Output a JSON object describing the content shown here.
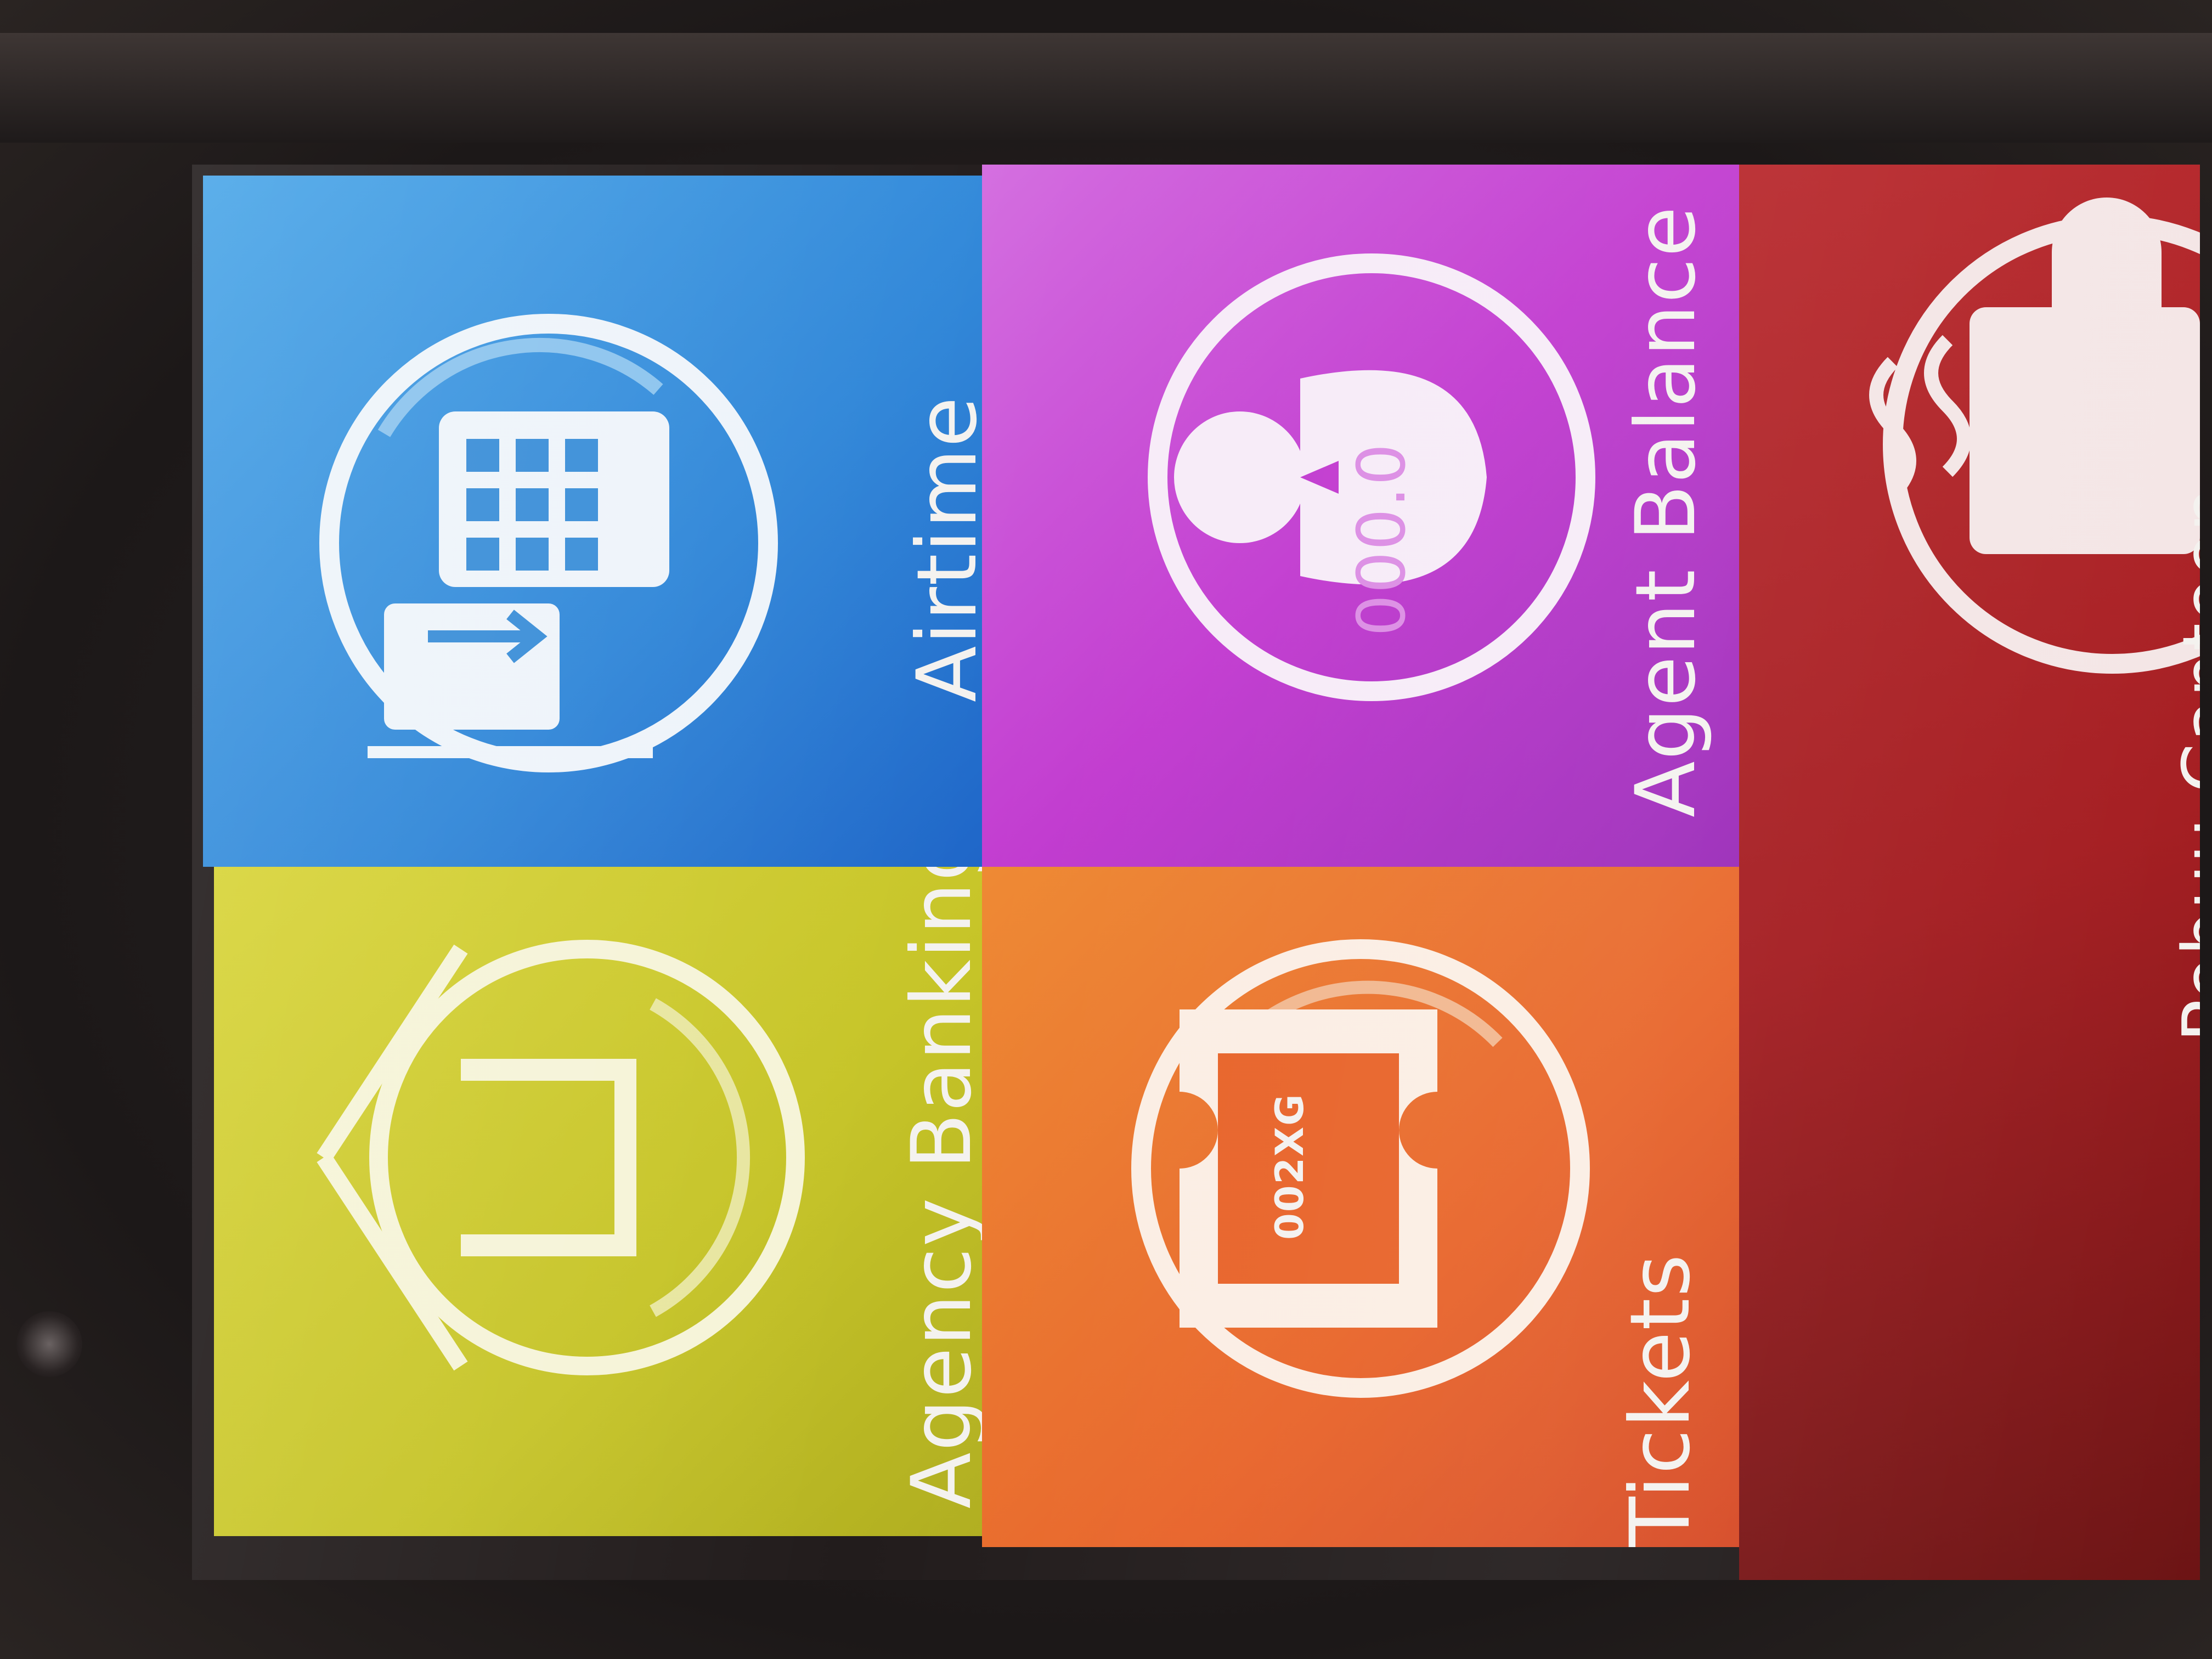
{
  "tiles": {
    "airtime": {
      "label": "Airtime",
      "color": "#2f86d8"
    },
    "agency_banking": {
      "label": "Agency Banking",
      "color": "#c6c428"
    },
    "agent_balance": {
      "label": "Agent Balance",
      "balance_display": "000.0",
      "color": "#c23cd0"
    },
    "tickets": {
      "label": "Tickets",
      "ticket_code": "002XG",
      "color": "#e8642a"
    },
    "canteen": {
      "label": "Pebuu Canteen",
      "color": "#a41c20"
    }
  },
  "icons": {
    "airtime": "phone-topup-icon",
    "agency_banking": "bank-upload-icon",
    "agent_balance": "agent-person-icon",
    "tickets": "ticket-icon",
    "canteen": "coffee-cup-icon"
  }
}
